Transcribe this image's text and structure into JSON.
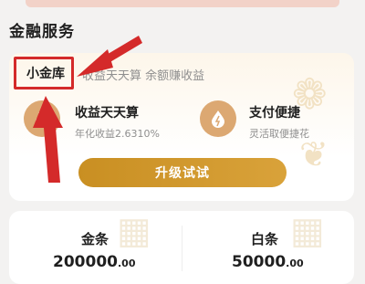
{
  "section": {
    "title": "金融服务"
  },
  "product": {
    "name": "小金库",
    "tagline": "收益天天算 余额赚收益"
  },
  "features": [
    {
      "icon": "bag-icon",
      "title": "收益天天算",
      "desc": "年化收益2.6310%"
    },
    {
      "icon": "drop-icon",
      "title": "支付便捷",
      "desc": "灵活取便捷花"
    }
  ],
  "upgrade_button": {
    "label": "升级试试"
  },
  "credits": [
    {
      "label": "金条",
      "amount": "200000",
      "decimal": ".00"
    },
    {
      "label": "白条",
      "amount": "50000",
      "decimal": ".00"
    }
  ],
  "colors": {
    "accent_gold": "#d9a23a",
    "icon_tan": "#dca872",
    "annotation_red": "#d42a2a"
  }
}
